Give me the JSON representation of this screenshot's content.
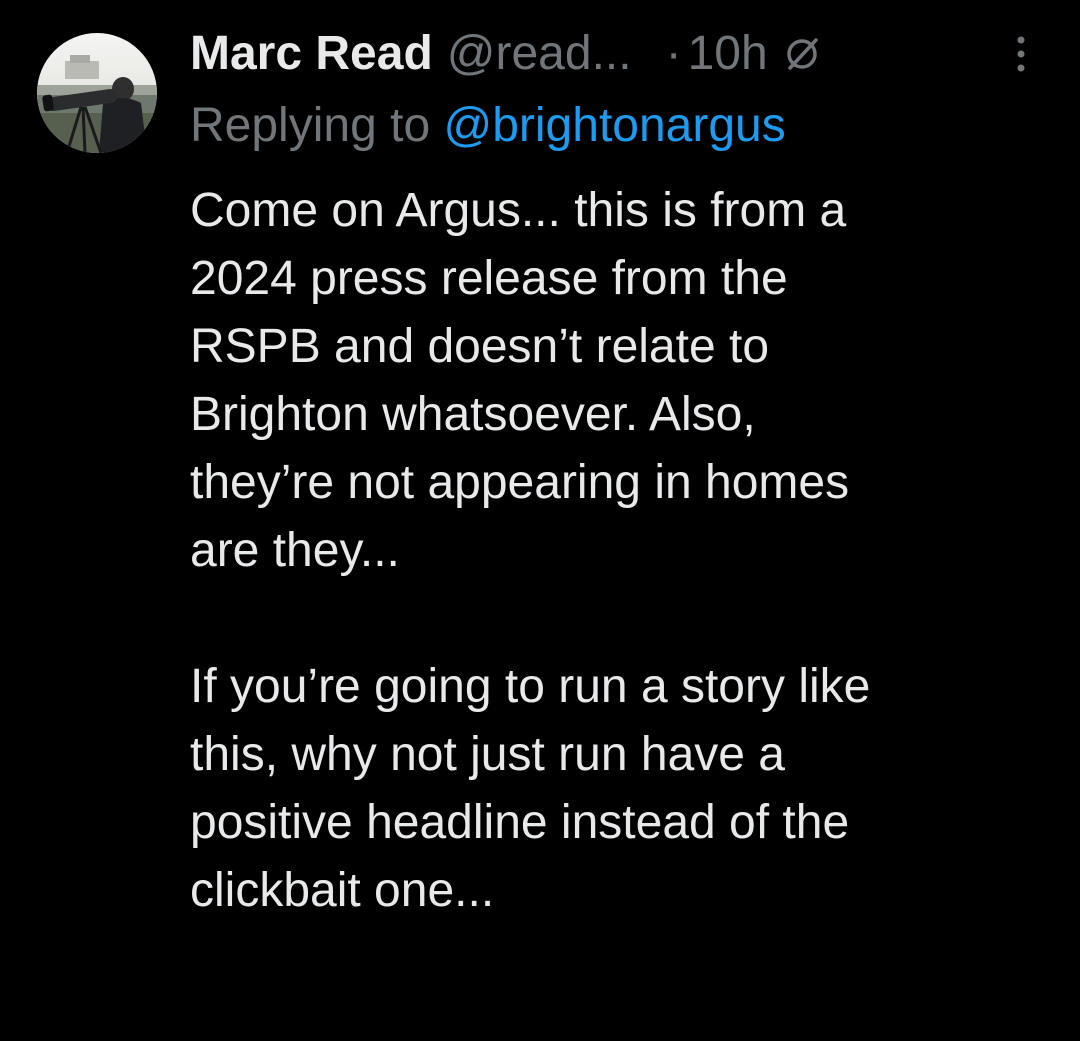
{
  "tweet": {
    "author": {
      "display_name": "Marc Read",
      "handle": "@read...",
      "avatar_icon": "profile-photo-birder-with-telescope"
    },
    "separator": "·",
    "time": "10h",
    "edited_icon": "edited-slash-circle-icon",
    "more_icon": "vertical-ellipsis-icon",
    "reply": {
      "prefix": "Replying to",
      "mention": "@brightonargus"
    },
    "paragraphs": [
      {
        "lines": [
          "Come on Argus... this is from a",
          "2024 press release from the",
          "RSPB and doesn’t relate to",
          "Brighton whatsoever. Also,",
          "they’re not appearing in homes",
          "are they..."
        ]
      },
      {
        "lines": [
          "If you’re going to run a story like",
          "this, why not just run have a",
          "positive headline instead of the",
          "clickbait one..."
        ]
      }
    ]
  },
  "colors": {
    "background": "#000000",
    "primary_text": "#e7e9ea",
    "secondary_text": "#71767b",
    "link": "#1d9bf0"
  }
}
